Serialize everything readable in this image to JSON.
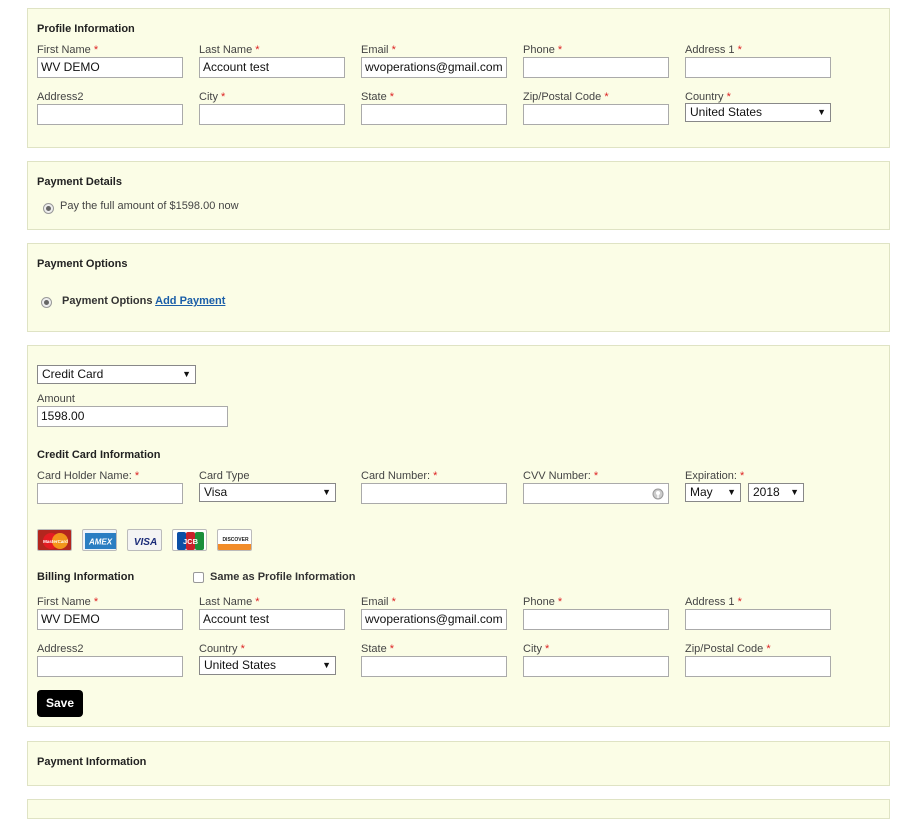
{
  "profile": {
    "title": "Profile Information",
    "first_name_label": "First Name",
    "first_name_value": "WV DEMO",
    "last_name_label": "Last Name",
    "last_name_value": "Account test",
    "email_label": "Email",
    "email_value": "wvoperations@gmail.com",
    "phone_label": "Phone",
    "phone_value": "",
    "address1_label": "Address 1",
    "address1_value": "",
    "address2_label": "Address2",
    "address2_value": "",
    "city_label": "City",
    "city_value": "",
    "state_label": "State",
    "state_value": "",
    "zip_label": "Zip/Postal Code",
    "zip_value": "",
    "country_label": "Country",
    "country_value": "United States"
  },
  "payment_details": {
    "title": "Payment Details",
    "option_label": "Pay the full amount of $1598.00 now"
  },
  "payment_options": {
    "title": "Payment Options",
    "option_label": "Payment Options",
    "add_payment_link": "Add Payment"
  },
  "payment": {
    "method_value": "Credit Card",
    "amount_label": "Amount",
    "amount_value": "1598.00",
    "cc_title": "Credit Card Information",
    "holder_label": "Card Holder Name:",
    "holder_value": "",
    "card_type_label": "Card Type",
    "card_type_value": "Visa",
    "card_number_label": "Card Number:",
    "card_number_value": "",
    "cvv_label": "CVV Number:",
    "cvv_value": "",
    "expiration_label": "Expiration:",
    "exp_month_value": "May",
    "exp_year_value": "2018",
    "card_logos": {
      "mastercard": "MasterCard",
      "amex": "AMEX",
      "visa": "VISA",
      "jcb": "JCB",
      "discover": "DISCOVER"
    }
  },
  "billing": {
    "title": "Billing Information",
    "same_as_label": "Same as Profile Information",
    "first_name_label": "First Name",
    "first_name_value": "WV DEMO",
    "last_name_label": "Last Name",
    "last_name_value": "Account test",
    "email_label": "Email",
    "email_value": "wvoperations@gmail.com",
    "phone_label": "Phone",
    "phone_value": "",
    "address1_label": "Address 1",
    "address1_value": "",
    "address2_label": "Address2",
    "address2_value": "",
    "country_label": "Country",
    "country_value": "United States",
    "state_label": "State",
    "state_value": "",
    "city_label": "City",
    "city_value": "",
    "zip_label": "Zip/Postal Code",
    "zip_value": "",
    "save_label": "Save"
  },
  "payment_information": {
    "title": "Payment Information"
  },
  "colors": {
    "panel_bg": "#fbfde6",
    "panel_border": "#dfe3c4",
    "required": "#d22",
    "link": "#1a5ea8",
    "save_bg": "#000000"
  }
}
